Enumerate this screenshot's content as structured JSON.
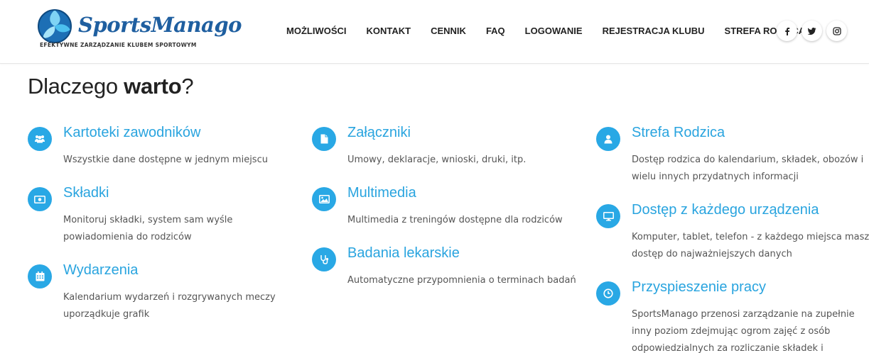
{
  "logo": {
    "name": "SportsManago",
    "tagline": "EFEKTYWNE ZARZĄDZANIE KLUBEM SPORTOWYM"
  },
  "nav": {
    "items": [
      {
        "label": "MOŻLIWOŚCI"
      },
      {
        "label": "KONTAKT"
      },
      {
        "label": "CENNIK"
      },
      {
        "label": "FAQ"
      },
      {
        "label": "LOGOWANIE"
      },
      {
        "label": "REJESTRACJA KLUBU"
      },
      {
        "label": "STREFA RODZICA"
      }
    ]
  },
  "social": [
    {
      "icon": "facebook-icon"
    },
    {
      "icon": "twitter-icon"
    },
    {
      "icon": "instagram-icon"
    }
  ],
  "section": {
    "title_prefix": "Dlaczego ",
    "title_bold": "warto",
    "title_suffix": "?"
  },
  "features": [
    {
      "icon": "users-icon",
      "title": "Kartoteki zawodników",
      "desc": "Wszystkie dane dostępne w jednym miejscu"
    },
    {
      "icon": "money-icon",
      "title": "Składki",
      "desc": "Monitoruj składki, system sam wyśle powiadomienia do rodziców"
    },
    {
      "icon": "calendar-icon",
      "title": "Wydarzenia",
      "desc": "Kalendarium wydarzeń i rozgrywanych meczy uporządkuje grafik"
    },
    {
      "icon": "file-icon",
      "title": "Załączniki",
      "desc": "Umowy, deklaracje, wnioski, druki, itp."
    },
    {
      "icon": "image-icon",
      "title": "Multimedia",
      "desc": "Multimedia z treningów dostępne dla rodziców"
    },
    {
      "icon": "stethoscope-icon",
      "title": "Badania lekarskie",
      "desc": "Automatyczne przypomnienia o terminach badań"
    },
    {
      "icon": "user-icon",
      "title": "Strefa Rodzica",
      "desc": "Dostęp rodzica do kalendarium, składek, obozów i wielu innych przydatnych informacji"
    },
    {
      "icon": "desktop-icon",
      "title": "Dostęp z każdego urządzenia",
      "desc": "Komputer, tablet, telefon - z każdego miejsca masz dostęp do najważniejszych danych"
    },
    {
      "icon": "clock-icon",
      "title": "Przyspieszenie pracy",
      "desc": "SportsManago przenosi zarządzanie na zupełnie inny poziom zdejmując ogrom zajęć z osób odpowiedzialnych za rozliczanie składek i"
    }
  ],
  "colors": {
    "accent": "#29a8e5",
    "logo_blue": "#1f5fa0",
    "text_dark": "#222222",
    "text_muted": "#555555"
  }
}
